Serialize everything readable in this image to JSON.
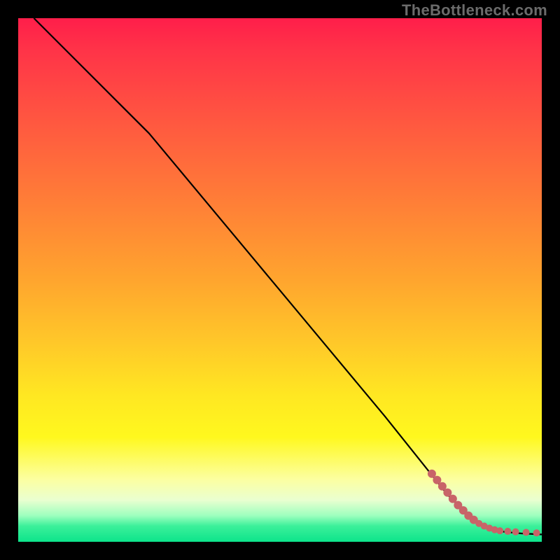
{
  "watermark_text": "TheBottleneck.com",
  "chart_data": {
    "type": "line",
    "title": "",
    "xlabel": "",
    "ylabel": "",
    "xlim": [
      0,
      100
    ],
    "ylim": [
      0,
      100
    ],
    "grid": false,
    "legend": false,
    "series": [
      {
        "name": "curve",
        "style": "solid-black",
        "x": [
          3,
          10,
          20,
          25,
          30,
          40,
          50,
          60,
          70,
          78,
          82,
          86,
          88,
          90,
          92,
          94,
          96,
          98,
          100
        ],
        "y": [
          100,
          93,
          83,
          78,
          72,
          60,
          48,
          36,
          24,
          14,
          9,
          5,
          3.5,
          2.5,
          2,
          1.8,
          1.6,
          1.5,
          1.4
        ]
      }
    ],
    "points": {
      "name": "highlighted-points",
      "color": "#c86468",
      "x": [
        79,
        80,
        81,
        82,
        83,
        84,
        85,
        86,
        87,
        88,
        89,
        90,
        91,
        92,
        93.5,
        95,
        97,
        99
      ],
      "y": [
        13,
        11.8,
        10.6,
        9.4,
        8.2,
        7,
        6,
        5,
        4.2,
        3.5,
        3,
        2.6,
        2.3,
        2.1,
        2,
        1.9,
        1.8,
        1.7
      ]
    }
  }
}
